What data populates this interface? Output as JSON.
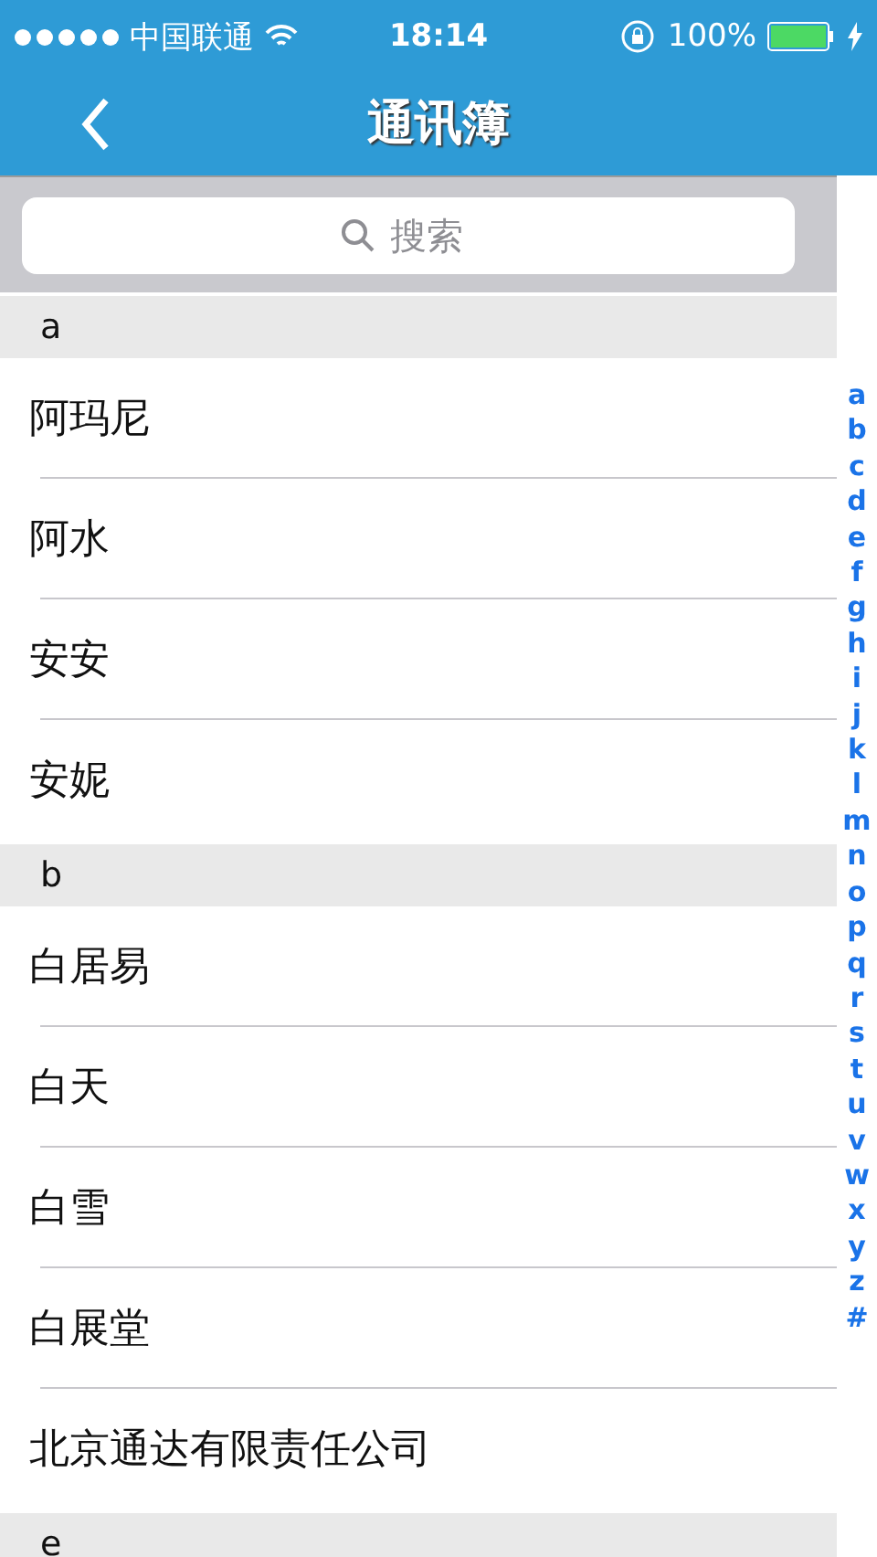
{
  "status_bar": {
    "carrier": "中国联通",
    "time": "18:14",
    "battery": "100%"
  },
  "nav_bar": {
    "title": "通讯簿"
  },
  "search": {
    "placeholder": "搜索"
  },
  "sections": [
    {
      "letter": "a",
      "contacts": [
        {
          "name": "阿玛尼"
        },
        {
          "name": "阿水"
        },
        {
          "name": "安安"
        },
        {
          "name": "安妮"
        }
      ]
    },
    {
      "letter": "b",
      "contacts": [
        {
          "name": "白居易"
        },
        {
          "name": "白天"
        },
        {
          "name": "白雪"
        },
        {
          "name": "白展堂"
        },
        {
          "name": "北京通达有限责任公司"
        }
      ]
    },
    {
      "letter": "e"
    }
  ],
  "index": [
    "a",
    "b",
    "c",
    "d",
    "e",
    "f",
    "g",
    "h",
    "i",
    "j",
    "k",
    "l",
    "m",
    "n",
    "o",
    "p",
    "q",
    "r",
    "s",
    "t",
    "u",
    "v",
    "w",
    "x",
    "y",
    "z",
    "#"
  ]
}
